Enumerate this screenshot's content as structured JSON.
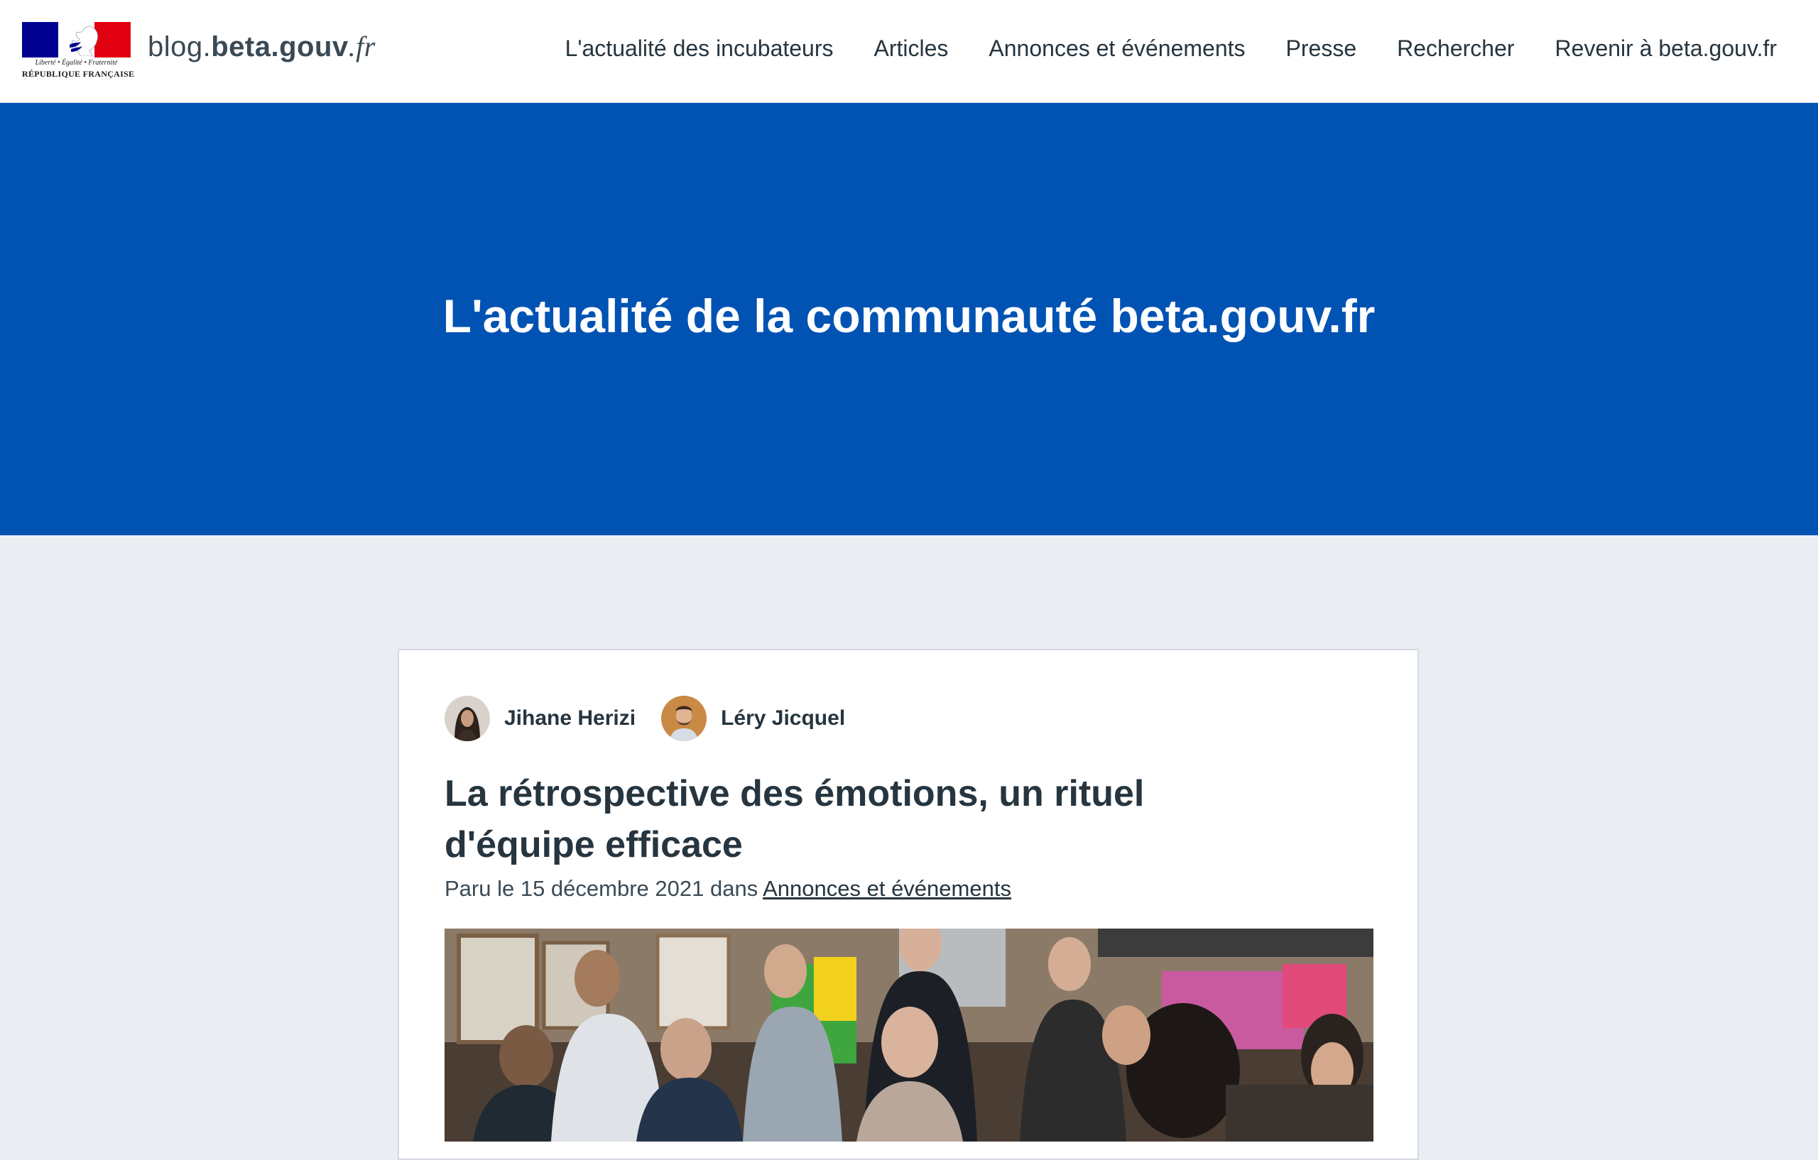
{
  "header": {
    "logo": {
      "motto": "Liberté • Égalité • Fraternité",
      "republique": "RÉPUBLIQUE FRANÇAISE"
    },
    "site_name": {
      "prefix": "blog.",
      "main": "beta.gouv",
      "suffix": ".fr"
    },
    "nav": [
      {
        "label": "L'actualité des incubateurs"
      },
      {
        "label": "Articles"
      },
      {
        "label": "Annonces et événements"
      },
      {
        "label": "Presse"
      },
      {
        "label": "Rechercher"
      },
      {
        "label": "Revenir à beta.gouv.fr"
      }
    ]
  },
  "hero": {
    "title": "L'actualité de la communauté beta.gouv.fr"
  },
  "article": {
    "authors": [
      {
        "name": "Jihane Herizi"
      },
      {
        "name": "Léry Jicquel"
      }
    ],
    "title": "La rétrospective des émotions, un rituel d'équipe efficace",
    "meta_prefix": "Paru le 15 décembre 2021 dans",
    "category": "Annonces et événements"
  },
  "colors": {
    "hero_bg": "#0053b3",
    "page_bg": "#eaedf2",
    "text": "#26353f"
  }
}
